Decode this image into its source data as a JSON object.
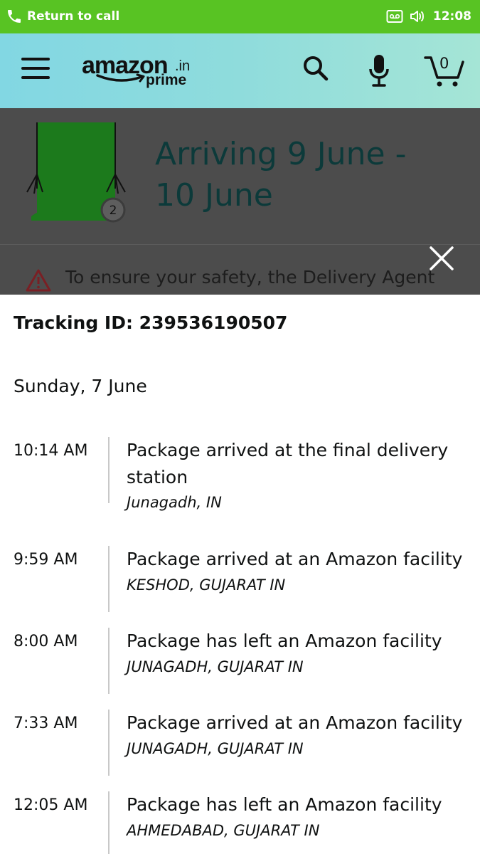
{
  "status_bar": {
    "call_label": "Return to call",
    "time": "12:08"
  },
  "header": {
    "logo_word": "amazon",
    "logo_tld": ".in",
    "logo_prime": "prime",
    "cart_count": "0"
  },
  "order": {
    "arriving_line1": "Arriving 9 June -",
    "arriving_line2": "10 June",
    "quantity": "2",
    "safety_notice": "To ensure your safety, the Delivery Agent"
  },
  "tracking": {
    "tracking_id": "Tracking ID: 239536190507",
    "date": "Sunday, 7 June",
    "events": [
      {
        "time": "10:14 AM",
        "status": "Package arrived at the final delivery station",
        "location": "Junagadh, IN"
      },
      {
        "time": "9:59 AM",
        "status": "Package arrived at an Amazon facility",
        "location": "KESHOD, GUJARAT IN"
      },
      {
        "time": "8:00 AM",
        "status": "Package has left an Amazon facility",
        "location": "JUNAGADH, GUJARAT IN"
      },
      {
        "time": "7:33 AM",
        "status": "Package arrived at an Amazon facility",
        "location": "JUNAGADH, GUJARAT IN"
      },
      {
        "time": "12:05 AM",
        "status": "Package has left an Amazon facility",
        "location": "AHMEDABAD, GUJARAT IN"
      }
    ]
  },
  "colors": {
    "status_bar": "#58c323",
    "header_gradient_start": "#82d7e3",
    "header_gradient_end": "#a5e5d6",
    "overlay": "#4c4c4c",
    "arriving_text": "#0c3a3a",
    "product_green": "#1f8f1f"
  }
}
